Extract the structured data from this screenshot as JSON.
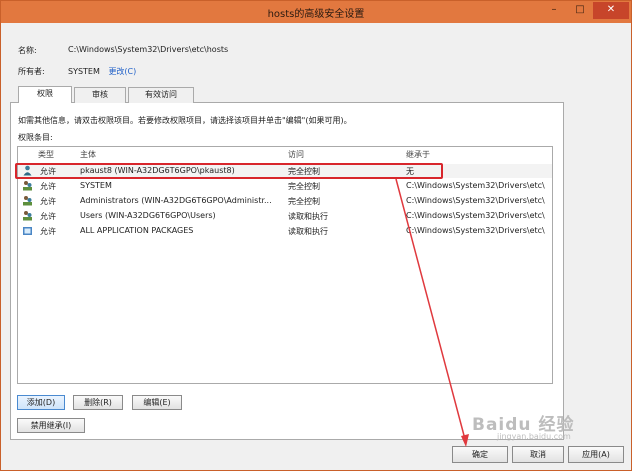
{
  "window": {
    "title": "hosts的高级安全设置",
    "min_glyph": "–",
    "max_glyph": "□",
    "close_glyph": "✕"
  },
  "fields": {
    "name_label": "名称:",
    "name_value": "C:\\Windows\\System32\\Drivers\\etc\\hosts",
    "owner_label": "所有者:",
    "owner_value": "SYSTEM",
    "owner_change": "更改(C)"
  },
  "tabs": [
    {
      "label": "权限",
      "active": true
    },
    {
      "label": "审核",
      "active": false
    },
    {
      "label": "有效访问",
      "active": false
    }
  ],
  "hint": "如需其他信息，请双击权限项目。若要修改权限项目，请选择该项目并单击\"编辑\"(如果可用)。",
  "list_title": "权限条目:",
  "columns": [
    "类型",
    "主体",
    "访问",
    "继承于"
  ],
  "rows": [
    {
      "type": "允许",
      "principal": "pkaust8 (WIN-A32DG6T6GPO\\pkaust8)",
      "access": "完全控制",
      "inherited": "无",
      "icon": "user-icon"
    },
    {
      "type": "允许",
      "principal": "SYSTEM",
      "access": "完全控制",
      "inherited": "C:\\Windows\\System32\\Drivers\\etc\\",
      "icon": "group-icon"
    },
    {
      "type": "允许",
      "principal": "Administrators (WIN-A32DG6T6GPO\\Administr...",
      "access": "完全控制",
      "inherited": "C:\\Windows\\System32\\Drivers\\etc\\",
      "icon": "group-icon"
    },
    {
      "type": "允许",
      "principal": "Users (WIN-A32DG6T6GPO\\Users)",
      "access": "读取和执行",
      "inherited": "C:\\Windows\\System32\\Drivers\\etc\\",
      "icon": "group-icon"
    },
    {
      "type": "允许",
      "principal": "ALL APPLICATION PACKAGES",
      "access": "读取和执行",
      "inherited": "C:\\Windows\\System32\\Drivers\\etc\\",
      "icon": "package-icon"
    }
  ],
  "buttons": {
    "add": "添加(D)",
    "remove": "删除(R)",
    "edit": "编辑(E)",
    "disable_inheritance": "禁用继承(I)",
    "ok": "确定",
    "cancel": "取消",
    "apply": "应用(A)"
  },
  "watermark": {
    "text": "Baidu 经验",
    "sub": "jingyan.baidu.com"
  },
  "colors": {
    "titlebar": "#e2783f",
    "highlight": "#d8262c",
    "arrow": "#e0393e",
    "link": "#2060c8"
  }
}
